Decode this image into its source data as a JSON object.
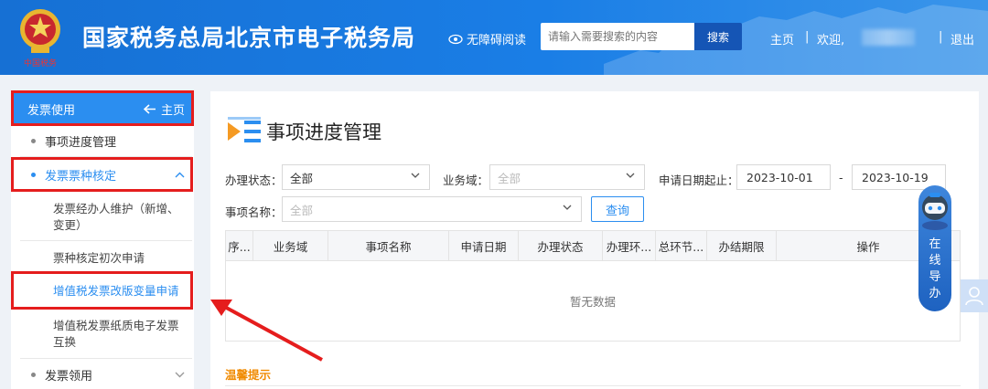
{
  "header": {
    "site_title": "国家税务总局北京市电子税务局",
    "accessibility": "无障碍阅读",
    "search_placeholder": "请输入需要搜索的内容",
    "search_button": "搜索",
    "home": "主页",
    "welcome": "欢迎,",
    "separator": "|",
    "logout": "退出",
    "emblem_caption": "中国税务"
  },
  "sidebar": {
    "header_title": "发票使用",
    "header_home": "主页",
    "items": [
      {
        "label": "事项进度管理"
      },
      {
        "label": "发票票种核定",
        "active": true
      },
      {
        "label": "发票领用"
      }
    ],
    "sub_items": [
      {
        "label": "发票经办人维护（新增、变更）"
      },
      {
        "label": "票种核定初次申请"
      },
      {
        "label": "增值税发票改版变量申请",
        "active": true
      },
      {
        "label": "增值税发票纸质电子发票互换"
      }
    ]
  },
  "main": {
    "page_title": "事项进度管理",
    "filters": {
      "status_label": "办理状态：",
      "status_value": "全部",
      "domain_label": "业务域：",
      "domain_placeholder": "全部",
      "date_label": "申请日期起止：",
      "date_start": "2023-10-01",
      "date_dash": "-",
      "date_end": "2023-10-19",
      "name_label": "事项名称：",
      "name_placeholder": "全部",
      "query_button": "查询"
    },
    "table": {
      "columns": [
        "序...",
        "业务域",
        "事项名称",
        "申请日期",
        "办理状态",
        "办理环...",
        "总环节...",
        "办结期限",
        "操作"
      ],
      "empty_text": "暂无数据"
    },
    "tips_title": "温馨提示"
  },
  "assistant": {
    "label": [
      "在",
      "线",
      "导",
      "办"
    ]
  },
  "colors": {
    "header_blue": "#1a7ee6",
    "sidebar_blue": "#2b8ef0",
    "highlight_red": "#e51d1d",
    "tips_orange": "#f08a00"
  }
}
